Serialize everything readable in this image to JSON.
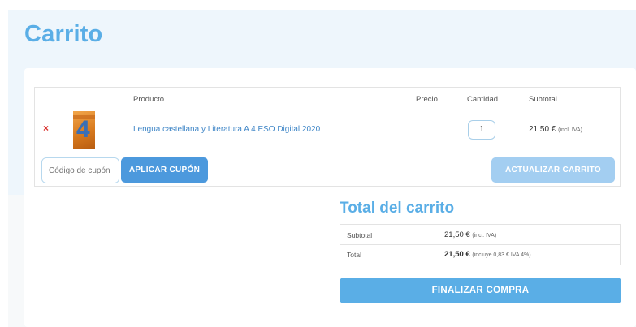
{
  "page": {
    "title": "Carrito"
  },
  "cart": {
    "columns": {
      "product": "Producto",
      "price": "Precio",
      "quantity": "Cantidad",
      "subtotal": "Subtotal"
    },
    "remove_symbol": "×",
    "items": [
      {
        "thumbnail_icon": "book-cover-icon",
        "thumbnail_glyph": "4",
        "name": "Lengua castellana y Literatura A 4 ESO Digital 2020",
        "price": "",
        "quantity": "1",
        "subtotal": "21,50 €",
        "subtotal_note": "(incl. IVA)"
      }
    ],
    "coupon_placeholder": "Código de cupón",
    "apply_coupon_label": "APLICAR CUPÓN",
    "update_cart_label": "ACTUALIZAR CARRITO"
  },
  "totals": {
    "title": "Total del carrito",
    "subtotal_label": "Subtotal",
    "subtotal_value": "21,50 €",
    "subtotal_note": "(incl. IVA)",
    "total_label": "Total",
    "total_value": "21,50 €",
    "total_note": "(incluye 0,83 € IVA 4%)",
    "checkout_label": "FINALIZAR COMPRA"
  },
  "colors": {
    "accent": "#5aaee6",
    "button_primary": "#4c99dd",
    "button_disabled": "#a3cef1",
    "remove": "#d9302c",
    "link": "#3f86c7"
  }
}
